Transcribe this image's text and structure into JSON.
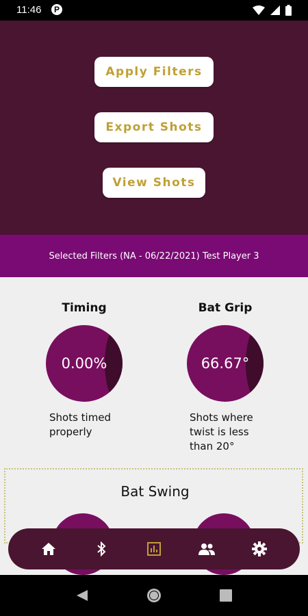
{
  "status": {
    "time": "11:46",
    "notification": "P"
  },
  "actions": {
    "apply": "Apply Filters",
    "export": "Export Shots",
    "view": "View Shots"
  },
  "filter_text": "Selected Filters (NA - 06/22/2021) Test Player 3",
  "stats": [
    {
      "title": "Timing",
      "value": "0.00%",
      "desc1": "Shots timed",
      "desc2": "properly",
      "desc3": ""
    },
    {
      "title": "Bat Grip",
      "value": "66.67°",
      "desc1": "Shots where",
      "desc2": "twist is less",
      "desc3": "than 20°"
    }
  ],
  "bat_swing": {
    "title": "Bat Swing"
  },
  "nav": [
    "home-icon",
    "bluetooth-icon",
    "chart-icon",
    "people-icon",
    "settings-icon"
  ],
  "colors": {
    "primary": "#4a1530",
    "accent": "#780e5e",
    "filter_bar": "#7a0a74",
    "gold": "#c0a035"
  }
}
